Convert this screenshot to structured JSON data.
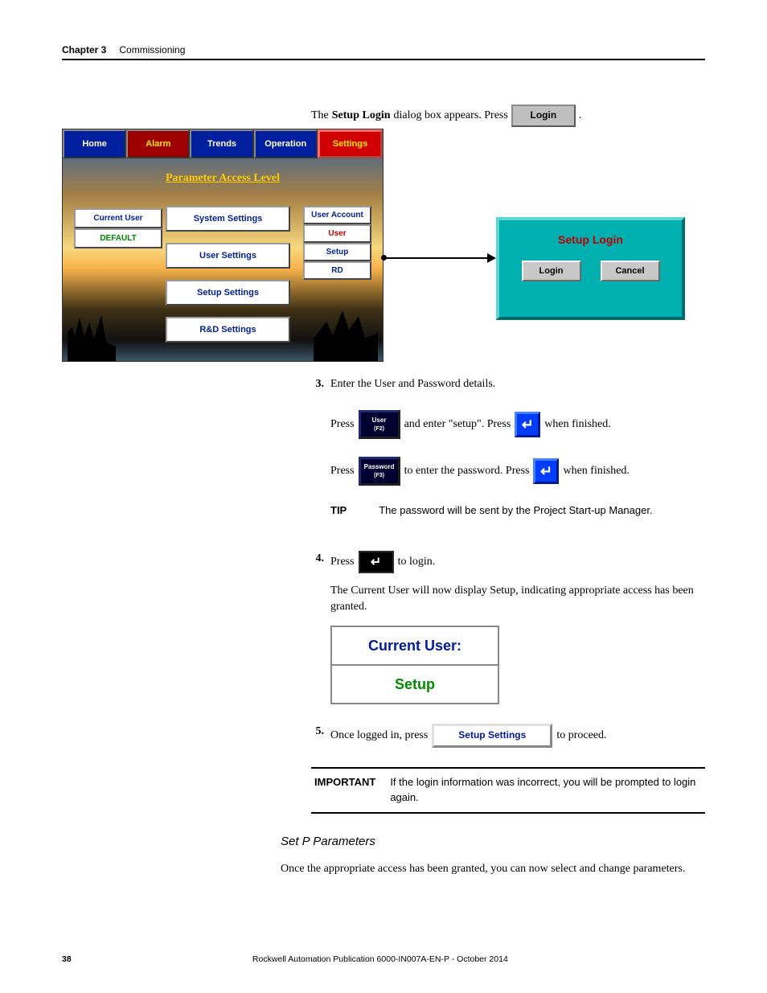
{
  "header": {
    "chapter": "Chapter 3",
    "title": "Commissioning"
  },
  "intro": {
    "pre": "The ",
    "bold": "Setup Login",
    "post": " dialog box appears. Press ",
    "btn": "Login",
    "tail": " ."
  },
  "hmi": {
    "tabs": [
      "Home",
      "Alarm",
      "Trends",
      "Operation",
      "Settings"
    ],
    "param_label": "Parameter Access Level",
    "current_user_label": "Current User",
    "default_user": "DEFAULT",
    "mid_buttons": [
      "System Settings",
      "User Settings",
      "Setup Settings",
      "R&D Settings"
    ],
    "right_buttons": [
      "User Account",
      "User",
      "Setup",
      "RD"
    ]
  },
  "dialog": {
    "title": "Setup Login",
    "login": "Login",
    "cancel": "Cancel"
  },
  "steps": {
    "s3": "Enter the User and Password details.",
    "row1_a": "Press ",
    "row1_key_top": "User",
    "row1_key_sub": "(F2)",
    "row1_b": " and enter \"setup\". Press ",
    "row1_c": " when finished.",
    "row2_a": "Press ",
    "row2_key_top": "Password",
    "row2_key_sub": "(F3)",
    "row2_b": " to enter the password. Press ",
    "row2_c": " when finished.",
    "tip_label": "TIP",
    "tip_body": "The password will be sent by the Project Start-up Manager.",
    "s4_a": "Press ",
    "s4_b": " to login.",
    "s4_para": "The Current User will now display Setup, indicating appropriate access has been granted.",
    "cu_label": "Current User:",
    "cu_value": "Setup",
    "s5_a": "Once logged in, press ",
    "s5_btn": "Setup Settings",
    "s5_b": " to proceed."
  },
  "important": {
    "label": "IMPORTANT",
    "text": "If the login information was incorrect, you will be prompted to login again."
  },
  "section": {
    "subhead": "Set P Parameters",
    "para": "Once the appropriate access has been granted, you can now select and change parameters."
  },
  "footer": {
    "page": "38",
    "pub": "Rockwell Automation Publication 6000-IN007A-EN-P - October 2014"
  }
}
